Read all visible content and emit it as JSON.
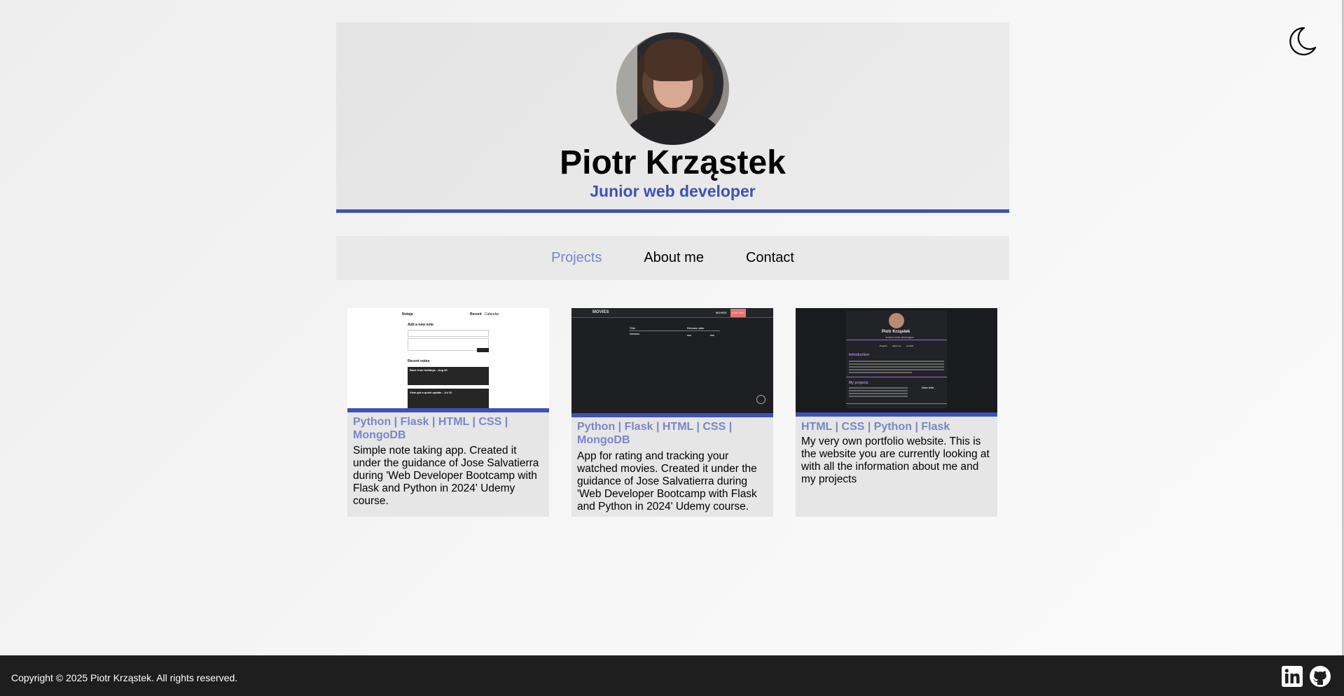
{
  "header": {
    "name": "Piotr Krząstek",
    "role": "Junior web developer"
  },
  "nav": {
    "items": [
      {
        "label": "Projects",
        "active": true
      },
      {
        "label": "About me",
        "active": false
      },
      {
        "label": "Contact",
        "active": false
      }
    ]
  },
  "projects": [
    {
      "tags": "Python | Flask | HTML | CSS | MongoDB",
      "description": "Simple note taking app. Created it under the guidance of Jose Salvatierra during 'Web Developer Bootcamp with Flask and Python in 2024' Udemy course.",
      "screenshot": {
        "brand": "Noteja",
        "nav": [
          "Recent",
          "Calendar"
        ],
        "heading": "Add a new note",
        "button": "Add note",
        "section": "Recent notes",
        "notes": [
          "Back from holidays - Aug 20",
          "View got a quick update - Jul 10"
        ]
      }
    },
    {
      "tags": "Python | Flask | HTML | CSS | MongoDB",
      "description": "App for rating and tracking your watched movies. Created it under the guidance of Jose Salvatierra during 'Web Developer Bootcamp with Flask and Python in 2024' Udemy course.",
      "screenshot": {
        "brand": "MOVIES",
        "nav": [
          "MOVIES",
          "LOG OUT"
        ],
        "columns": [
          "Title",
          "Release date"
        ]
      }
    },
    {
      "tags": "HTML | CSS | Python | Flask",
      "description": "My very own portfolio website. This is the website you are currently looking at with all the information about me and my projects",
      "screenshot": {
        "name": "Piotr Krząstek",
        "role": "Junior web developer",
        "nav": [
          "Projects",
          "About me",
          "Contact"
        ],
        "heading": "Introduction",
        "section": "My projects",
        "aside": "User info"
      }
    }
  ],
  "footer": {
    "copyright": "Copyright © 2025 Piotr Krząstek. All rights reserved."
  },
  "icons": {
    "theme_toggle": "moon-icon",
    "linkedin": "linkedin-icon",
    "github": "github-icon"
  },
  "colors": {
    "accent": "#3f51b5",
    "accent_light": "#7986cb",
    "footer_bg": "#1e1e1e"
  }
}
